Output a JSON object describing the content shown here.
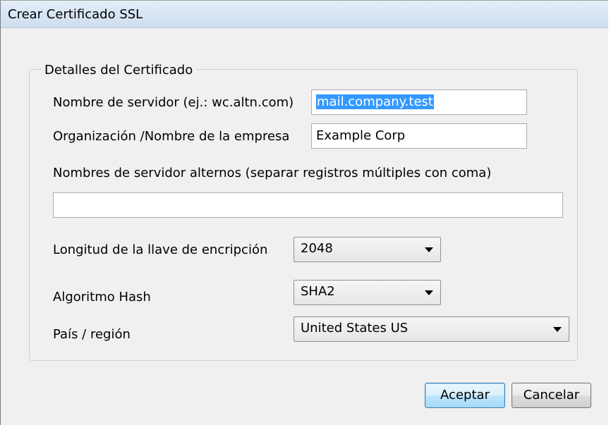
{
  "dialog": {
    "title": "Crear Certificado SSL"
  },
  "group": {
    "legend": "Detalles del Certificado"
  },
  "fields": {
    "server_name": {
      "label": "Nombre de servidor (ej.: wc.altn.com)",
      "value": "mail.company.test"
    },
    "organization": {
      "label": "Organización /Nombre de la empresa",
      "value": "Example Corp"
    },
    "alt_names": {
      "label": "Nombres de servidor alternos (separar registros múltiples con coma)",
      "value": ""
    },
    "key_length": {
      "label": "Longitud de la llave de encripción",
      "selected": "2048"
    },
    "hash_algorithm": {
      "label": "Algoritmo Hash",
      "selected": "SHA2"
    },
    "country": {
      "label": "País / región",
      "selected": "United States US"
    }
  },
  "buttons": {
    "ok": "Aceptar",
    "cancel": "Cancelar"
  },
  "colors": {
    "selection": "#3399ff",
    "default_button_border": "#3c7fb1"
  }
}
